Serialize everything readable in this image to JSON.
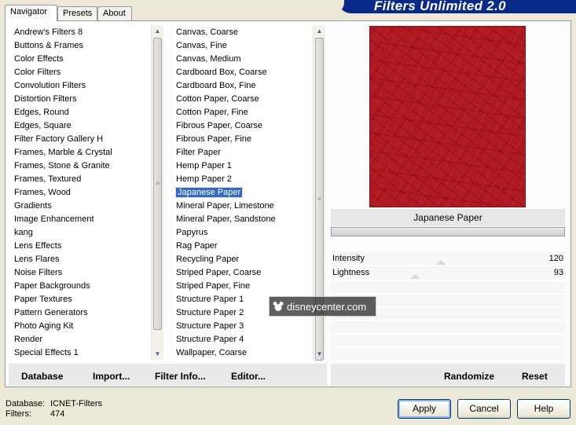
{
  "tabs": [
    {
      "label": "Navigator",
      "active": true
    },
    {
      "label": "Presets",
      "active": false
    },
    {
      "label": "About",
      "active": false
    }
  ],
  "banner": {
    "title": "Filters Unlimited 2.0"
  },
  "categories": {
    "items": [
      "Andrew's Filters 8",
      "Buttons & Frames",
      "Color Effects",
      "Color Filters",
      "Convolution Filters",
      "Distortion Filters",
      "Edges, Round",
      "Edges, Square",
      "Filter Factory Gallery H",
      "Frames, Marble & Crystal",
      "Frames, Stone & Granite",
      "Frames, Textured",
      "Frames, Wood",
      "Gradients",
      "Image Enhancement",
      "kang",
      "Lens Effects",
      "Lens Flares",
      "Noise Filters",
      "Paper Backgrounds",
      "Paper Textures",
      "Pattern Generators",
      "Photo Aging Kit",
      "Render",
      "Special Effects 1"
    ]
  },
  "filters": {
    "items": [
      "Canvas, Coarse",
      "Canvas, Fine",
      "Canvas, Medium",
      "Cardboard Box, Coarse",
      "Cardboard Box, Fine",
      "Cotton Paper, Coarse",
      "Cotton Paper, Fine",
      "Fibrous Paper, Coarse",
      "Fibrous Paper, Fine",
      "Filter Paper",
      "Hemp Paper 1",
      "Hemp Paper 2",
      "Japanese Paper",
      "Mineral Paper, Limestone",
      "Mineral Paper, Sandstone",
      "Papyrus",
      "Rag Paper",
      "Recycling Paper",
      "Striped Paper, Coarse",
      "Striped Paper, Fine",
      "Structure Paper 1",
      "Structure Paper 2",
      "Structure Paper 3",
      "Structure Paper 4",
      "Wallpaper, Coarse"
    ],
    "selected_index": 12
  },
  "preview": {
    "filter_name": "Japanese Paper",
    "texture_color": "#b11a22"
  },
  "parameters": [
    {
      "label": "Intensity",
      "value": "120"
    },
    {
      "label": "Lightness",
      "value": "93"
    }
  ],
  "toolbar": {
    "database": "Database",
    "import": "Import...",
    "filter_info": "Filter Info...",
    "editor": "Editor...",
    "randomize": "Randomize",
    "reset": "Reset"
  },
  "footer": {
    "database_label": "Database:",
    "database_value": "ICNET-Filters",
    "filters_label": "Filters:",
    "filters_value": "474"
  },
  "buttons": {
    "apply": "Apply",
    "cancel": "Cancel",
    "help": "Help"
  },
  "watermark": {
    "text": "disneycenter.com"
  },
  "colors": {
    "selection": "#316ac5",
    "banner": "#0a2a8a",
    "dialog": "#ece9d8"
  }
}
